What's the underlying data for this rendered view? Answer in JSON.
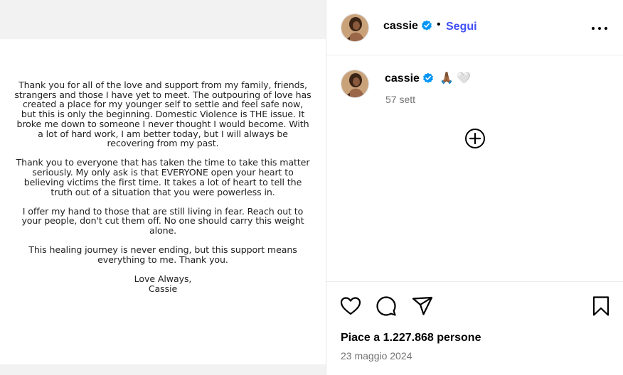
{
  "post": {
    "letter": {
      "paragraphs": [
        "Thank you for all of the love and support from my family, friends, strangers and those I have yet to meet. The outpouring of love has created a place for my younger self to settle and feel safe now, but this is only the beginning. Domestic Violence is THE issue. It broke me down to someone I never thought I would become. With a lot of hard work, I am better today, but I will always be recovering from my past.",
        "Thank you to everyone that has taken the time to take this matter seriously. My only ask is that EVERYONE open your heart to believing victims the first time. It takes a lot of heart to tell the truth out of a situation that you were powerless in.",
        "I offer my hand to those that are still living in fear. Reach out to your people, don't cut them off. No one should carry this weight alone.",
        "This healing journey is never ending, but this support means everything to me. Thank you."
      ],
      "closing": "Love Always,",
      "signature": "Cassie"
    }
  },
  "header": {
    "username": "cassie",
    "separator": "•",
    "follow_label": "Segui"
  },
  "caption": {
    "username": "cassie",
    "emojis": "🙏🏾 🤍",
    "time_ago": "57 sett"
  },
  "engagement": {
    "likes_text": "Piace a 1.227.868 persone",
    "date": "23 maggio 2024"
  },
  "icons": {
    "verified": "verified-badge-icon",
    "more": "more-options-icon",
    "add": "add-comment-icon",
    "like": "heart-icon",
    "comment": "comment-icon",
    "share": "share-icon",
    "save": "bookmark-icon"
  },
  "colors": {
    "follow_blue": "#4150f7",
    "verified_blue": "#0095f6",
    "muted_text": "#737373"
  }
}
